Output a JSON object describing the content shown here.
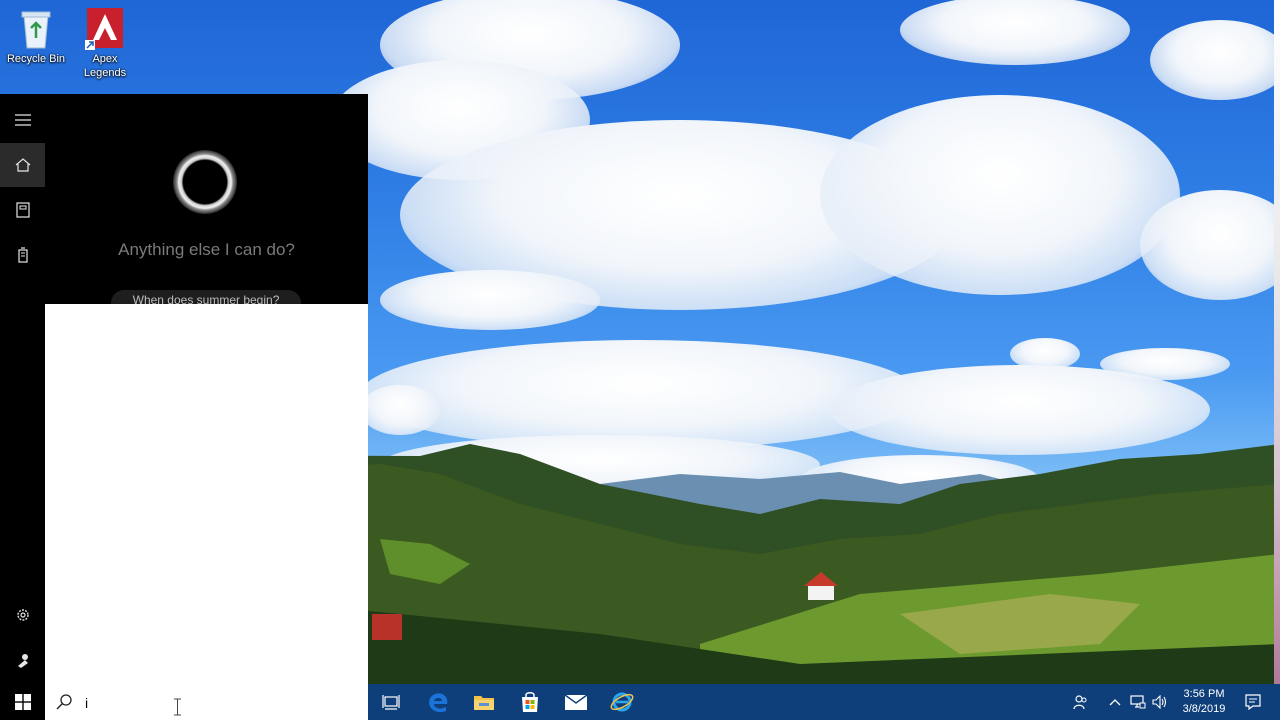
{
  "desktop": {
    "icons": [
      {
        "label": "Recycle Bin",
        "icon": "recycle-bin-icon"
      },
      {
        "label": "Apex Legends",
        "icon": "apex-legends-icon"
      }
    ]
  },
  "start_rail": {
    "items": [
      {
        "icon": "hamburger-menu-icon"
      },
      {
        "icon": "home-icon"
      },
      {
        "icon": "notebook-icon"
      },
      {
        "icon": "device-icon"
      },
      {
        "icon": "gear-icon"
      },
      {
        "icon": "feedback-icon"
      }
    ]
  },
  "cortana": {
    "prompt": "Anything else I can do?",
    "suggestion": "When does summer begin?"
  },
  "search": {
    "value": "i",
    "icon": "search-icon"
  },
  "taskbar": {
    "apps": [
      {
        "icon": "task-view-icon"
      },
      {
        "icon": "edge-icon"
      },
      {
        "icon": "file-explorer-icon"
      },
      {
        "icon": "store-icon"
      },
      {
        "icon": "mail-icon"
      },
      {
        "icon": "internet-explorer-icon"
      }
    ],
    "tray": [
      {
        "icon": "people-icon"
      },
      {
        "icon": "chevron-up-icon"
      },
      {
        "icon": "network-icon"
      },
      {
        "icon": "volume-icon"
      }
    ],
    "clock": {
      "time": "3:56 PM",
      "date": "3/8/2019"
    },
    "notification_icon": "action-center-icon"
  },
  "colors": {
    "taskbar": "#0f3f7a",
    "start_rail": "#000000",
    "edge_blue": "#1a73d9",
    "explorer_yellow": "#f2c34b",
    "apex_red": "#c8202c"
  }
}
